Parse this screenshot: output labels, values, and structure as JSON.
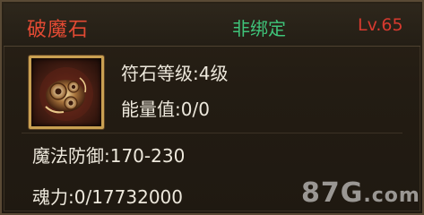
{
  "item": {
    "name": "破魔石",
    "bind_state": "非绑定",
    "level_req": "Lv.65",
    "icon": "rune-stone-icon"
  },
  "stats": {
    "rune_level": "符石等级:4级",
    "energy": "能量值:0/0",
    "magic_defense": "魔法防御:170-230",
    "soul_power": "魂力:0/17732000"
  },
  "watermark": {
    "text": "87G",
    "suffix": ".com"
  },
  "colors": {
    "name": "#e24a33",
    "bind_state": "#3fc47a",
    "level_req": "#d73a2f",
    "frame": "#c9a052"
  }
}
